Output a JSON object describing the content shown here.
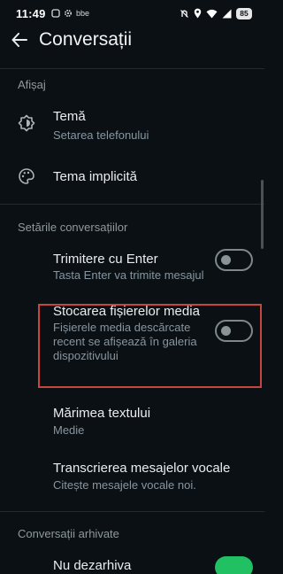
{
  "status_bar": {
    "time": "11:49",
    "left_icons": [
      "notification-icon",
      "settings-icon",
      "bluetooth-icon"
    ],
    "left_text": "bbe",
    "right_icons": [
      "do-not-disturb-icon",
      "location-icon",
      "wifi-icon",
      "signal-icon"
    ],
    "battery": "85"
  },
  "app_bar": {
    "title": "Conversații"
  },
  "sections": {
    "display": "Afișaj",
    "chat_settings": "Setările conversațiilor",
    "archived": "Conversații arhivate"
  },
  "items": {
    "theme": {
      "title": "Temă",
      "subtitle": "Setarea telefonului"
    },
    "default_theme": {
      "title": "Tema implicită"
    },
    "enter_send": {
      "title": "Trimitere cu Enter",
      "subtitle": "Tasta Enter va trimite mesajul",
      "enabled": false
    },
    "media_storage": {
      "title": "Stocarea fișierelor media",
      "subtitle": "Fișierele media descărcate recent se afișează în galeria dispozitivului",
      "enabled": false
    },
    "text_size": {
      "title": "Mărimea textului",
      "subtitle": "Medie"
    },
    "voice_transcripts": {
      "title": "Transcrierea mesajelor vocale",
      "subtitle": "Citește mesajele vocale noi."
    },
    "keep_archived": {
      "title": "Nu dezarhiva",
      "enabled": true
    }
  },
  "colors": {
    "background": "#0b1014",
    "accent": "#21c063",
    "highlight": "#c7443f"
  }
}
